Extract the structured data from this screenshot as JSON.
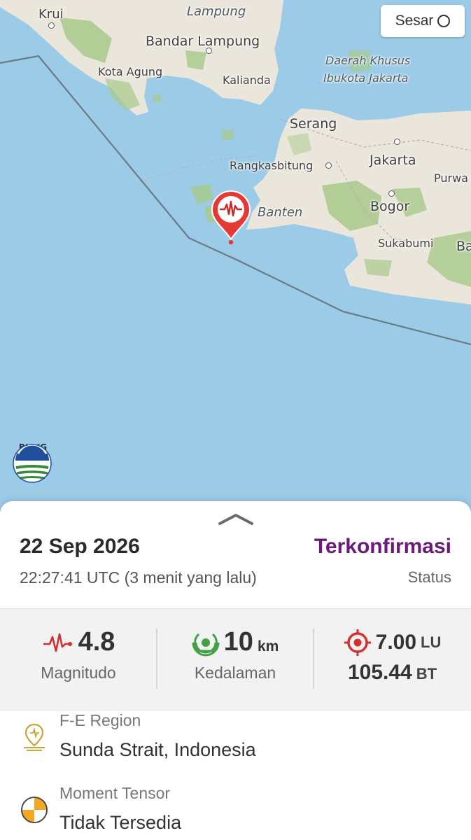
{
  "map": {
    "labels": {
      "krui": "Krui",
      "lampung": "Lampung",
      "bandar_lampung": "Bandar Lampung",
      "kota_agung": "Kota Agung",
      "kalianda": "Kalianda",
      "dki_1": "Daerah Khusus",
      "dki_2": "Ibukota Jakarta",
      "serang": "Serang",
      "rangkasbitung": "Rangkasbitung",
      "jakarta": "Jakarta",
      "purwa": "Purwa",
      "banten": "Banten",
      "bogor": "Bogor",
      "sukabumi": "Sukabumi",
      "ba": "Ba"
    },
    "fault_toggle": {
      "label": "Sesar",
      "state": "off"
    },
    "logo_text": "BMKG",
    "colors": {
      "sea": "#9ccbe7",
      "land": "#ebe6dc",
      "forest": "#a8c98a",
      "pin": "#e53935"
    }
  },
  "event": {
    "date": "22 Sep 2026",
    "time": "22:27:41 UTC",
    "relative": "(3 menit yang lalu)",
    "status_value": "Terkonfirmasi",
    "status_label": "Status",
    "magnitude": "4.8",
    "magnitude_label": "Magnitudo",
    "depth_value": "10",
    "depth_unit": "km",
    "depth_label": "Kedalaman",
    "lat_value": "7.00",
    "lat_unit": "LU",
    "lon_value": "105.44",
    "lon_unit": "BT",
    "region_label": "F-E Region",
    "region_value": "Sunda Strait, Indonesia",
    "tensor_label": "Moment Tensor",
    "tensor_value": "Tidak Tersedia"
  }
}
